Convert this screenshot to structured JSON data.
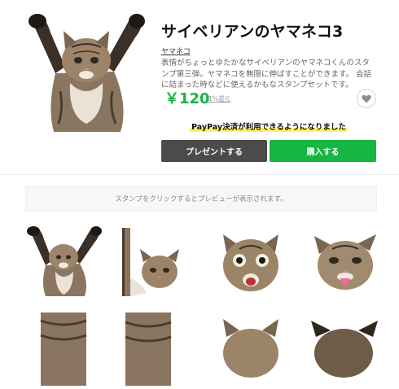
{
  "product": {
    "title": "サイベリアンのヤマネコ3",
    "author": "ヤマネコ",
    "description": "表情がちょっとゆたかなサイベリアンのヤマネコくんのスタンプ第三弾。ヤマネコを無限に伸ばすことができます。 会話に詰まった時などに使えるかもなスタンプセットです。",
    "price": "￥120",
    "coin_link": "1%還元",
    "paypay_notice": "PayPay決済が利用できるようになりました"
  },
  "actions": {
    "gift_label": "プレゼントする",
    "buy_label": "購入する"
  },
  "preview": {
    "hint": "スタンプをクリックするとプレビューが表示されます。"
  },
  "colors": {
    "accent_green": "#17b541",
    "gift_button": "#4b4b4b",
    "highlight": "#fff06a"
  },
  "icons": {
    "favorite": "heart-icon"
  },
  "stickers": [
    {
      "name": "cat-arms-raised"
    },
    {
      "name": "cat-peeking-side"
    },
    {
      "name": "cat-surprised-face"
    },
    {
      "name": "cat-tongue-out-face"
    },
    {
      "name": "cat-stretch-body"
    },
    {
      "name": "cat-stretch-body-2"
    },
    {
      "name": "cat-head-partial"
    },
    {
      "name": "cat-head-partial-2"
    }
  ]
}
